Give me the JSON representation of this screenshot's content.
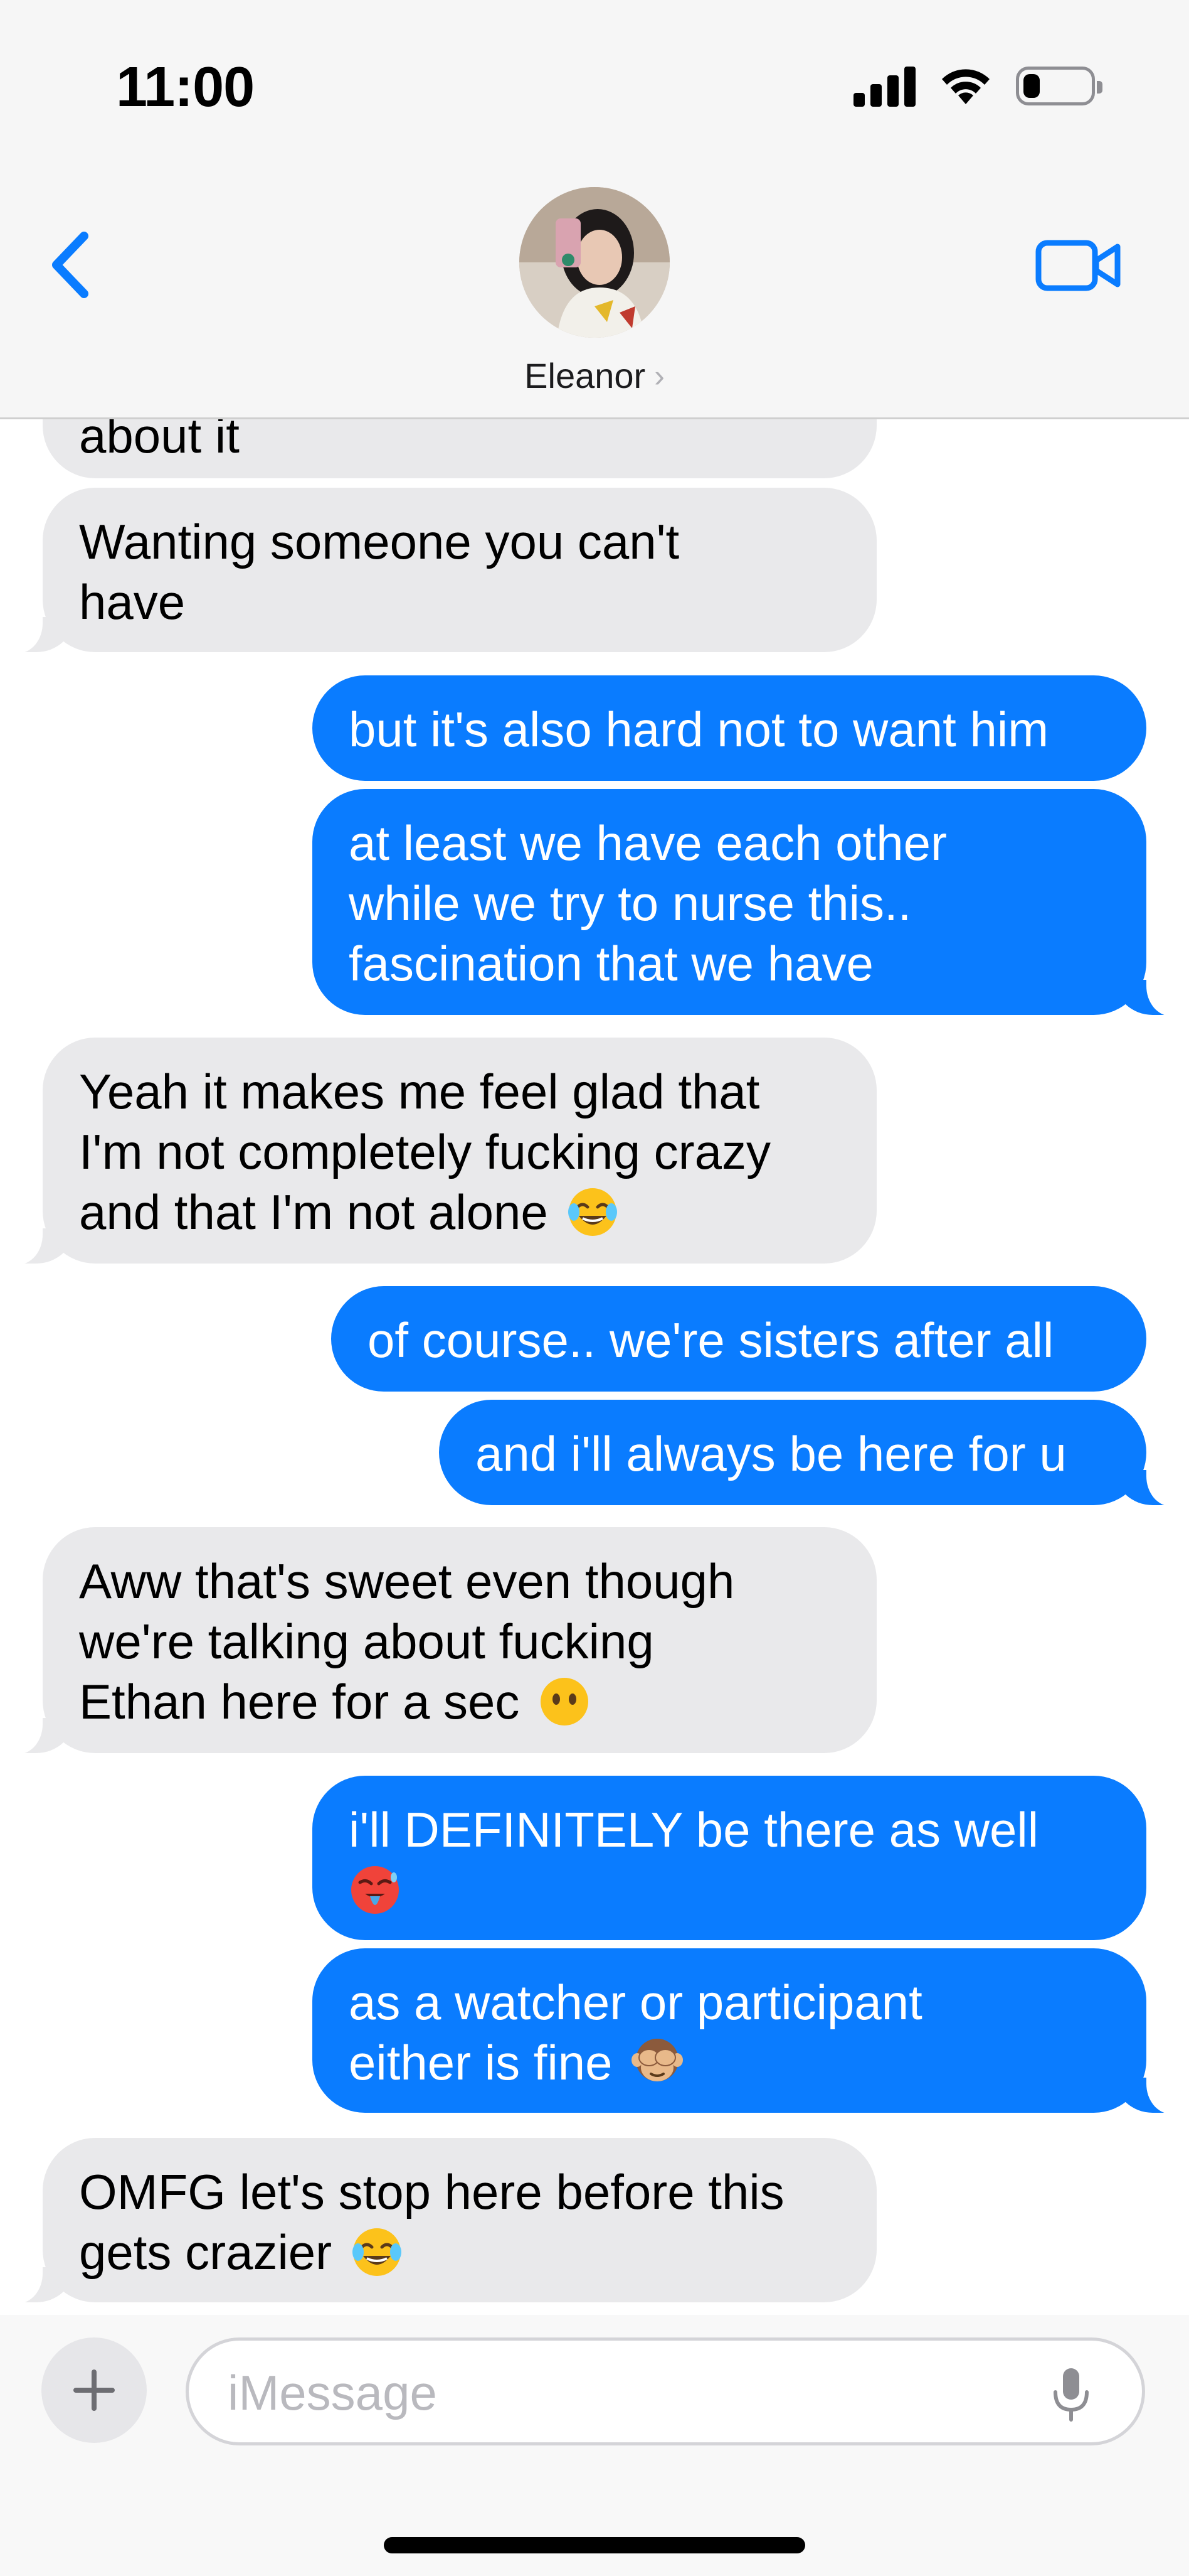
{
  "status_bar": {
    "time": "11:00",
    "battery_level": 0.25
  },
  "header": {
    "contact_name": "Eleanor",
    "back_icon": "chevron-left-icon",
    "video_icon": "video-camera-icon"
  },
  "colors": {
    "sent_bubble": "#0a7cff",
    "received_bubble": "#e9e9eb",
    "accent": "#0a7cff"
  },
  "messages": [
    {
      "direction": "received",
      "text_lines": [
        "about it"
      ],
      "emoji": null
    },
    {
      "direction": "received",
      "text_lines": [
        "Wanting someone you can't",
        "have"
      ],
      "emoji": null
    },
    {
      "direction": "sent",
      "text_lines": [
        "but it's also hard not to want him"
      ],
      "emoji": null
    },
    {
      "direction": "sent",
      "text_lines": [
        "at least we have each other",
        "while we try to nurse this..",
        "fascination that we have"
      ],
      "emoji": null
    },
    {
      "direction": "received",
      "text_lines": [
        "Yeah it makes me feel glad that",
        "I'm not completely fucking crazy",
        "and that I'm not alone"
      ],
      "emoji": "face-with-tears-of-joy"
    },
    {
      "direction": "sent",
      "text_lines": [
        "of course.. we're sisters after all"
      ],
      "emoji": null
    },
    {
      "direction": "sent",
      "text_lines": [
        "and i'll always be here for u"
      ],
      "emoji": null
    },
    {
      "direction": "received",
      "text_lines": [
        "Aww that's sweet even though",
        "we're talking about fucking",
        "Ethan here for a sec"
      ],
      "emoji": "face-without-mouth"
    },
    {
      "direction": "sent",
      "text_lines": [
        "i'll DEFINITELY be there as well",
        ""
      ],
      "emoji": "hot-face"
    },
    {
      "direction": "sent",
      "text_lines": [
        "as a watcher or participant",
        "either is fine"
      ],
      "emoji": "see-no-evil-monkey"
    },
    {
      "direction": "received",
      "text_lines": [
        "OMFG let's stop here before this",
        "gets crazier"
      ],
      "emoji": "face-with-tears-of-joy"
    }
  ],
  "compose": {
    "placeholder": "iMessage",
    "value": "",
    "plus_icon": "plus-icon",
    "mic_icon": "microphone-icon"
  }
}
